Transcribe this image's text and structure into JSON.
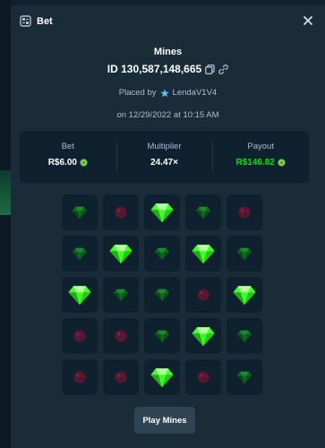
{
  "modal": {
    "title": "Bet",
    "game_name": "Mines",
    "bet_id": "ID 130,587,148,665",
    "placed_by_prefix": "Placed by",
    "username": "LendaV1V4",
    "date_text": "on 12/29/2022 at 10:15 AM"
  },
  "stats": {
    "bet_label": "Bet",
    "bet_value": "R$6.00",
    "multiplier_label": "Multiplier",
    "multiplier_value": "24.47×",
    "payout_label": "Payout",
    "payout_value": "R$146.82"
  },
  "board": {
    "rows": [
      [
        "gem-dim",
        "mine",
        "gem-revealed",
        "gem-dim",
        "mine"
      ],
      [
        "gem-dim",
        "gem-revealed",
        "gem-dim",
        "gem-revealed",
        "gem-dim"
      ],
      [
        "gem-revealed",
        "gem-dim",
        "gem-dim",
        "mine",
        "gem-revealed"
      ],
      [
        "mine",
        "mine",
        "gem-dim",
        "gem-revealed",
        "gem-dim"
      ],
      [
        "mine",
        "mine",
        "gem-revealed",
        "mine",
        "gem-dim"
      ]
    ]
  },
  "actions": {
    "play_label": "Play Mines"
  },
  "icons": {
    "title_icon": "bet-slip-icon",
    "close_icon": "close-icon",
    "copy_icon": "copy-icon",
    "link_icon": "link-icon",
    "vip_icon": "star-icon",
    "coin_icon": "coin-icon",
    "gem_icon": "gem-icon",
    "mine_icon": "mine-icon"
  },
  "colors": {
    "background": "#0f212e",
    "panel": "#1a2c38",
    "tile": "#0f212e",
    "button": "#2f4553",
    "gem_bright": "#3cff26",
    "gem_dim": "#0e6b1c",
    "mine": "#5a1830",
    "payout_green": "#00e701",
    "muted_text": "#b1bad3"
  }
}
